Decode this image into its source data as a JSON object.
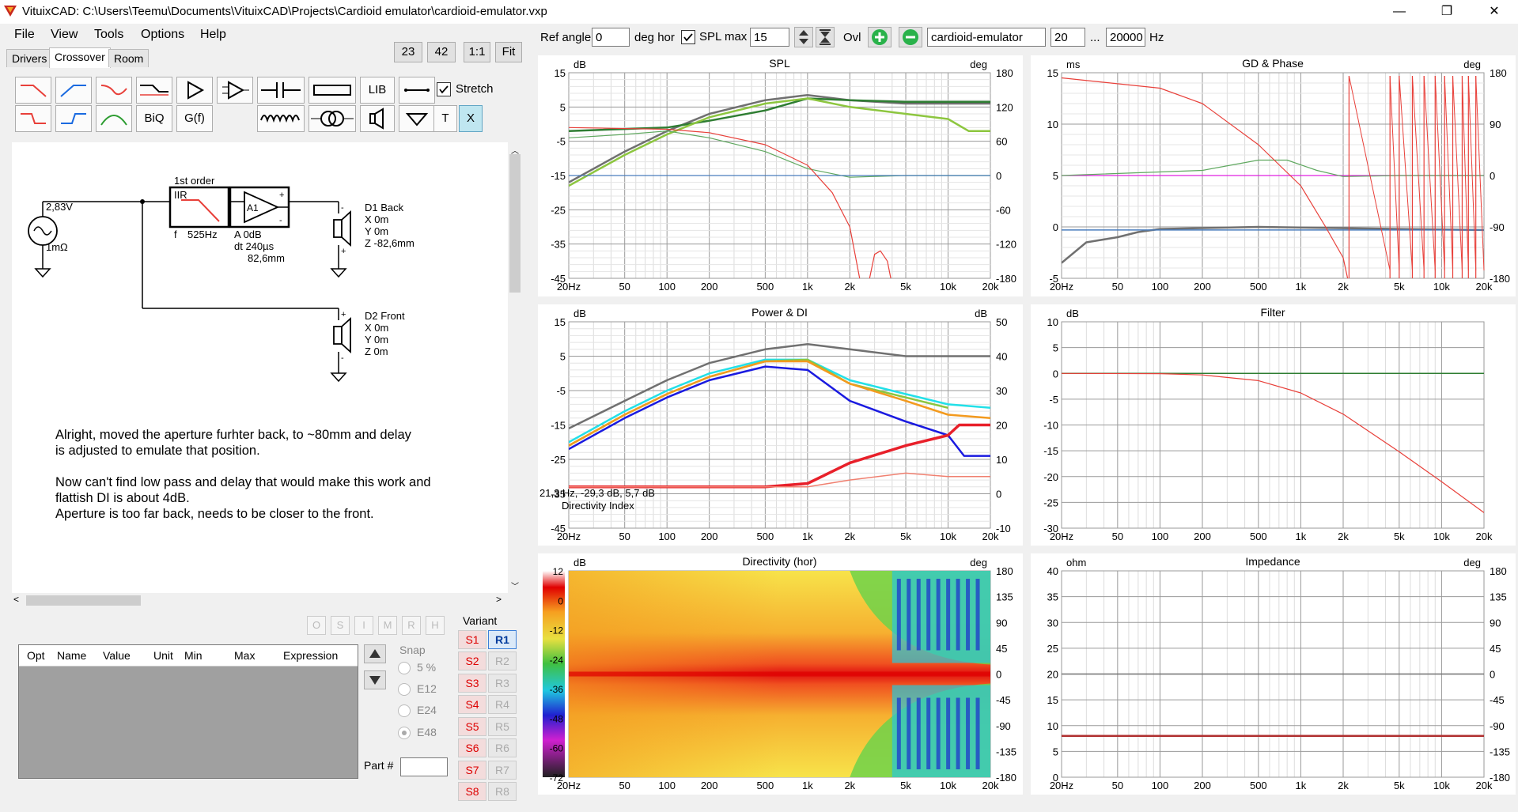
{
  "window": {
    "title": "VituixCAD: C:\\Users\\Teemu\\Documents\\VituixCAD\\Projects\\Cardioid emulator\\cardioid-emulator.vxp",
    "minimize": "—",
    "maximize": "❐",
    "close": "✕"
  },
  "menu": [
    "File",
    "View",
    "Tools",
    "Options",
    "Help"
  ],
  "tabs": [
    "Drivers",
    "Crossover",
    "Room"
  ],
  "zoom_buttons": [
    "23",
    "42",
    "1:1",
    "Fit"
  ],
  "toolbar": {
    "lib": "LIB",
    "biq": "BiQ",
    "gf": "G(f)",
    "t": "T",
    "x": "X",
    "stretch": "Stretch"
  },
  "schematic": {
    "source_v": "2,83V",
    "source_r": "1mΩ",
    "filter_order": "1st order",
    "filter_type": "IIR",
    "filter_f_label": "f",
    "filter_f": "525Hz",
    "amp_label": "A1",
    "amp_gain": "A  0dB",
    "amp_dt": "dt 240µs",
    "amp_dist": "82,6mm",
    "d1": [
      "D1 Back",
      "X 0m",
      "Y 0m",
      "Z -82,6mm"
    ],
    "d2": [
      "D2 Front",
      "X 0m",
      "Y 0m",
      "Z 0m"
    ],
    "note": [
      "Alright, moved the aperture furhter back, to ~80mm and delay",
      "is adjusted to emulate that position.",
      "",
      "Now can't find low pass and delay that would make this work and",
      "flattish DI is about 4dB.",
      "Aperture is too far back, needs to be closer to the front."
    ]
  },
  "opt_buttons": [
    "O",
    "S",
    "I",
    "M",
    "R",
    "H"
  ],
  "opt_table_headers": [
    "Opt",
    "Name",
    "Value",
    "Unit",
    "Min",
    "Max",
    "Expression"
  ],
  "snap": {
    "label": "Snap",
    "options": [
      "5 %",
      "E12",
      "E24",
      "E48"
    ]
  },
  "part_label": "Part #",
  "variant": {
    "label": "Variant",
    "s": [
      "S1",
      "S2",
      "S3",
      "S4",
      "S5",
      "S6",
      "S7",
      "S8"
    ],
    "r": [
      "R1",
      "R2",
      "R3",
      "R4",
      "R5",
      "R6",
      "R7",
      "R8"
    ]
  },
  "topbar": {
    "ref_angle_label": "Ref angle",
    "ref_angle": "0",
    "deg_hor": "deg hor",
    "spl_max_label": "SPL max",
    "spl_max": "15",
    "ovl": "Ovl",
    "project": "cardioid-emulator",
    "f_min": "20",
    "dots": "...",
    "f_max": "20000",
    "hz": "Hz"
  },
  "x_ticks": [
    "20Hz",
    "50",
    "100",
    "200",
    "500",
    "1k",
    "2k",
    "5k",
    "10k",
    "20k"
  ],
  "colors": {
    "red": "#e8403a",
    "green_dark": "#2e7d32",
    "green_light": "#8dc63f",
    "green_mid": "#5fa85f",
    "grey": "#707070",
    "blue": "#1a1ae0",
    "cyan": "#22e0e8",
    "orange": "#f39a1e",
    "magenta": "#e020e0"
  },
  "chart_data": [
    {
      "type": "line",
      "title": "SPL",
      "xlabel": "",
      "ylabel": "dB",
      "y2label": "deg",
      "x_scale": "log",
      "xlim": [
        20,
        20000
      ],
      "ylim": [
        -45,
        15
      ],
      "y2lim": [
        -180,
        180
      ],
      "y_ticks": [
        "15",
        "5",
        "-5",
        "-15",
        "-25",
        "-35",
        "-45"
      ],
      "y2_ticks": [
        "180",
        "120",
        "60",
        "0",
        "-60",
        "-120",
        "-180"
      ],
      "series": [
        {
          "color": "#707070",
          "width": 2.5,
          "points": [
            [
              20,
              -17
            ],
            [
              50,
              -8
            ],
            [
              100,
              -2
            ],
            [
              200,
              3
            ],
            [
              500,
              7
            ],
            [
              1000,
              8.5
            ],
            [
              2000,
              7
            ],
            [
              5000,
              6
            ],
            [
              10000,
              6
            ],
            [
              20000,
              6
            ]
          ]
        },
        {
          "color": "#2e7d32",
          "width": 2.5,
          "points": [
            [
              20,
              -2
            ],
            [
              100,
              -1
            ],
            [
              200,
              1
            ],
            [
              500,
              4
            ],
            [
              1000,
              7.5
            ],
            [
              2000,
              7
            ],
            [
              5000,
              6.5
            ],
            [
              10000,
              6.5
            ],
            [
              20000,
              6.5
            ]
          ]
        },
        {
          "color": "#8dc63f",
          "width": 2.5,
          "points": [
            [
              20,
              -18
            ],
            [
              50,
              -9
            ],
            [
              100,
              -3
            ],
            [
              200,
              2
            ],
            [
              500,
              6
            ],
            [
              1000,
              7.5
            ],
            [
              2000,
              5
            ],
            [
              5000,
              3
            ],
            [
              10000,
              1.5
            ],
            [
              14000,
              -2
            ],
            [
              20000,
              -2
            ]
          ]
        },
        {
          "color": "#5fa85f",
          "width": 1.2,
          "points": [
            [
              20,
              -4
            ],
            [
              50,
              -3
            ],
            [
              100,
              -2
            ],
            [
              200,
              -4
            ],
            [
              500,
              -8
            ],
            [
              1000,
              -13
            ],
            [
              2000,
              -15.5
            ],
            [
              5000,
              -15
            ],
            [
              10000,
              -15
            ],
            [
              20000,
              -15
            ]
          ]
        },
        {
          "color": "#4a7dbd",
          "width": 1.2,
          "points": [
            [
              20,
              -15
            ],
            [
              20000,
              -15
            ]
          ]
        },
        {
          "color": "#e8403a",
          "width": 1.2,
          "points": [
            [
              20,
              -1
            ],
            [
              100,
              -1.5
            ],
            [
              200,
              -2.5
            ],
            [
              500,
              -6
            ],
            [
              1000,
              -12
            ],
            [
              1500,
              -20
            ],
            [
              2000,
              -30
            ],
            [
              2400,
              -47
            ]
          ]
        },
        {
          "color": "#e8403a",
          "width": 1.2,
          "points": [
            [
              2700,
              -47
            ],
            [
              3000,
              -38
            ],
            [
              3300,
              -37
            ],
            [
              3700,
              -40
            ],
            [
              4000,
              -47
            ]
          ]
        }
      ]
    },
    {
      "type": "line",
      "title": "GD & Phase",
      "xlabel": "",
      "ylabel": "ms",
      "y2label": "deg",
      "x_scale": "log",
      "xlim": [
        20,
        20000
      ],
      "ylim": [
        -5,
        15
      ],
      "y2lim": [
        -180,
        180
      ],
      "y_ticks": [
        "15",
        "10",
        "5",
        "0",
        "-5"
      ],
      "y2_ticks": [
        "180",
        "90",
        "0",
        "-90",
        "-180"
      ],
      "series": [
        {
          "color": "#707070",
          "width": 2.5,
          "points": [
            [
              20,
              -3.5
            ],
            [
              30,
              -1.5
            ],
            [
              50,
              -1
            ],
            [
              70,
              -0.5
            ],
            [
              100,
              -0.2
            ],
            [
              500,
              0
            ],
            [
              5000,
              -0.2
            ],
            [
              20000,
              -0.3
            ]
          ]
        },
        {
          "color": "#4a7dbd",
          "width": 1.5,
          "points": [
            [
              20,
              -0.3
            ],
            [
              20000,
              -0.3
            ]
          ]
        },
        {
          "color": "#e020e0",
          "width": 1.2,
          "points": [
            [
              20,
              5
            ],
            [
              20000,
              5
            ]
          ]
        },
        {
          "color": "#5fa85f",
          "width": 1.2,
          "points": [
            [
              20,
              5
            ],
            [
              200,
              5.5
            ],
            [
              500,
              6.5
            ],
            [
              800,
              6.5
            ],
            [
              1300,
              5.5
            ],
            [
              2000,
              4.9
            ],
            [
              5000,
              5
            ],
            [
              20000,
              5
            ]
          ]
        },
        {
          "color": "#e8403a",
          "width": 1.2,
          "points": [
            [
              20,
              14.5
            ],
            [
              100,
              13.5
            ],
            [
              200,
              12
            ],
            [
              500,
              8
            ],
            [
              1000,
              4
            ],
            [
              1500,
              0
            ],
            [
              2000,
              -3
            ],
            [
              2150,
              -5
            ]
          ]
        }
      ]
    },
    {
      "type": "line",
      "title": "Power & DI",
      "xlabel": "",
      "ylabel": "dB",
      "y2label": "dB",
      "x_scale": "log",
      "xlim": [
        20,
        20000
      ],
      "ylim": [
        -45,
        15
      ],
      "y2lim": [
        -10,
        50
      ],
      "y_ticks": [
        "15",
        "5",
        "-5",
        "-15",
        "-25",
        "-35",
        "-45"
      ],
      "y2_ticks": [
        "50",
        "40",
        "30",
        "20",
        "10",
        "0",
        "-10"
      ],
      "readout": "21,3 Hz, -29,3 dB, 5,7 dB",
      "readout_label": "Directivity Index",
      "series": [
        {
          "color": "#707070",
          "width": 2.5,
          "points": [
            [
              20,
              -16
            ],
            [
              50,
              -8
            ],
            [
              100,
              -2
            ],
            [
              200,
              3
            ],
            [
              500,
              7
            ],
            [
              1000,
              8.5
            ],
            [
              2000,
              7
            ],
            [
              5000,
              5
            ],
            [
              10000,
              5
            ],
            [
              20000,
              5
            ]
          ]
        },
        {
          "color": "#22e0e8",
          "width": 2.5,
          "points": [
            [
              20,
              -20
            ],
            [
              50,
              -11
            ],
            [
              100,
              -5
            ],
            [
              200,
              0
            ],
            [
              500,
              4
            ],
            [
              1000,
              4
            ],
            [
              2000,
              -2
            ],
            [
              5000,
              -6
            ],
            [
              10000,
              -9
            ],
            [
              20000,
              -10
            ]
          ]
        },
        {
          "color": "#8dc63f",
          "width": 2.5,
          "points": [
            [
              20,
              -21
            ],
            [
              50,
              -12
            ],
            [
              100,
              -6
            ],
            [
              200,
              -1
            ],
            [
              500,
              3.5
            ],
            [
              1000,
              4
            ],
            [
              2000,
              -3
            ],
            [
              5000,
              -7
            ],
            [
              10000,
              -10
            ]
          ]
        },
        {
          "color": "#f39a1e",
          "width": 2.5,
          "points": [
            [
              20,
              -21
            ],
            [
              50,
              -12
            ],
            [
              100,
              -6
            ],
            [
              200,
              -1
            ],
            [
              500,
              3.5
            ],
            [
              1000,
              3.5
            ],
            [
              2000,
              -3
            ],
            [
              5000,
              -8
            ],
            [
              10000,
              -12
            ],
            [
              20000,
              -13
            ]
          ]
        },
        {
          "color": "#1a1ae0",
          "width": 2.5,
          "points": [
            [
              20,
              -22
            ],
            [
              50,
              -13
            ],
            [
              100,
              -7
            ],
            [
              200,
              -2
            ],
            [
              500,
              2
            ],
            [
              1000,
              1
            ],
            [
              2000,
              -8
            ],
            [
              5000,
              -14
            ],
            [
              10000,
              -18
            ],
            [
              13000,
              -24
            ],
            [
              20000,
              -24
            ]
          ]
        },
        {
          "color": "#e8202a",
          "width": 3.5,
          "points": [
            [
              20,
              -33
            ],
            [
              100,
              -33
            ],
            [
              500,
              -33
            ],
            [
              1000,
              -32
            ],
            [
              2000,
              -26
            ],
            [
              5000,
              -21
            ],
            [
              10000,
              -18
            ],
            [
              12000,
              -15
            ],
            [
              20000,
              -15
            ]
          ]
        },
        {
          "color": "#f08070",
          "width": 1.5,
          "points": [
            [
              20,
              -33
            ],
            [
              500,
              -33
            ],
            [
              1000,
              -33
            ],
            [
              2000,
              -31
            ],
            [
              5000,
              -29
            ],
            [
              10000,
              -30
            ],
            [
              20000,
              -30
            ]
          ]
        }
      ]
    },
    {
      "type": "line",
      "title": "Filter",
      "xlabel": "",
      "ylabel": "dB",
      "x_scale": "log",
      "xlim": [
        20,
        20000
      ],
      "ylim": [
        -30,
        10
      ],
      "y_ticks": [
        "10",
        "5",
        "0",
        "-5",
        "-10",
        "-15",
        "-20",
        "-25",
        "-30"
      ],
      "series": [
        {
          "color": "#2e7d32",
          "width": 1.5,
          "points": [
            [
              20,
              0
            ],
            [
              20000,
              0
            ]
          ]
        },
        {
          "color": "#e8403a",
          "width": 1.2,
          "points": [
            [
              20,
              0
            ],
            [
              100,
              -0.05
            ],
            [
              200,
              -0.3
            ],
            [
              500,
              -1.4
            ],
            [
              1000,
              -3.8
            ],
            [
              2000,
              -7.9
            ],
            [
              5000,
              -15.2
            ],
            [
              10000,
              -21
            ],
            [
              20000,
              -27
            ]
          ]
        }
      ]
    },
    {
      "type": "heatmap",
      "title": "Directivity (hor)",
      "xlabel": "",
      "ylabel": "dB",
      "y2label": "deg",
      "x_scale": "log",
      "xlim": [
        20,
        20000
      ],
      "y2lim": [
        -180,
        180
      ],
      "colorbar_ticks": [
        "12",
        "0",
        "-12",
        "-24",
        "-36",
        "-48",
        "-60",
        "-72"
      ],
      "y2_ticks": [
        "180",
        "135",
        "90",
        "45",
        "0",
        "-45",
        "-90",
        "-135",
        "-180"
      ]
    },
    {
      "type": "line",
      "title": "Impedance",
      "xlabel": "",
      "ylabel": "ohm",
      "y2label": "deg",
      "x_scale": "log",
      "xlim": [
        20,
        20000
      ],
      "ylim": [
        0,
        40
      ],
      "y2lim": [
        -180,
        180
      ],
      "y_ticks": [
        "40",
        "35",
        "30",
        "25",
        "20",
        "15",
        "10",
        "5",
        "0"
      ],
      "y2_ticks": [
        "180",
        "135",
        "90",
        "45",
        "0",
        "-45",
        "-90",
        "-135",
        "-180"
      ],
      "series": [
        {
          "color": "#707070",
          "width": 1.5,
          "points": [
            [
              20,
              20
            ],
            [
              20000,
              20
            ]
          ]
        },
        {
          "color": "#b03030",
          "width": 2.5,
          "points": [
            [
              20,
              8
            ],
            [
              20000,
              8
            ]
          ]
        }
      ]
    }
  ]
}
